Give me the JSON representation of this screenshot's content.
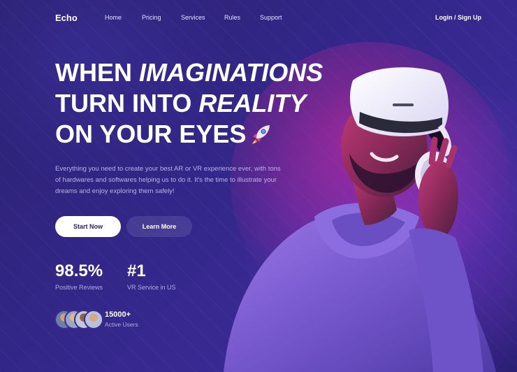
{
  "nav": {
    "logo": "Echo",
    "links": [
      "Home",
      "Pricing",
      "Services",
      "Rules",
      "Support"
    ],
    "login": "Login / Sign Up"
  },
  "hero": {
    "line1_a": "WHEN ",
    "line1_b": "IMAGINATIONS",
    "line2_a": "TURN INTO ",
    "line2_b": "REALITY",
    "line3": "ON YOUR EYES",
    "rocket_icon": "rocket-icon",
    "subtext": "Everything you need to create your best AR or VR experience ever, with tons of hardwares and softwares helping us to do it. It's the time to illustrate your dreams and enjoy exploring them safely!",
    "primary_button": "Start Now",
    "secondary_button": "Learn More"
  },
  "stats": [
    {
      "value": "98.5%",
      "label": "Positive Reviews"
    },
    {
      "value": "#1",
      "label": "VR Service in US"
    }
  ],
  "users": {
    "value": "15000+",
    "label": "Active Users"
  },
  "colors": {
    "background": "#2f2480",
    "accent_pink": "#e0279b",
    "accent_purple": "#8a3fd9",
    "hoodie": "#7d63d4",
    "button_primary_bg": "#ffffff"
  }
}
